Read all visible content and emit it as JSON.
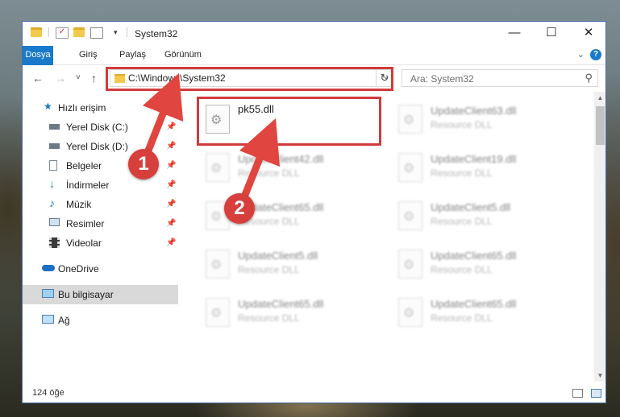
{
  "window": {
    "title": "System32",
    "controls": {
      "minimize": "—",
      "maximize": "☐",
      "close": "✕"
    }
  },
  "ribbon": {
    "tabs": [
      "Dosya",
      "Giriş",
      "Paylaş",
      "Görünüm"
    ],
    "help": "?"
  },
  "nav": {
    "back": "←",
    "forward": "→",
    "recent": "˅",
    "up": "↑",
    "address": "C:\\Windows\\System32",
    "refresh": "↻",
    "search_placeholder": "Ara: System32",
    "search_icon": "⚲"
  },
  "sidebar": {
    "items": [
      {
        "label": "Hızlı erişim",
        "icon": "star-icon",
        "pinned": false
      },
      {
        "label": "Yerel Disk (C:)",
        "icon": "drive-icon",
        "pinned": true
      },
      {
        "label": "Yerel Disk (D:)",
        "icon": "drive-icon",
        "pinned": true
      },
      {
        "label": "Belgeler",
        "icon": "documents-icon",
        "pinned": true
      },
      {
        "label": "İndirmeler",
        "icon": "download-icon",
        "pinned": true
      },
      {
        "label": "Müzik",
        "icon": "music-icon",
        "pinned": true
      },
      {
        "label": "Resimler",
        "icon": "pictures-icon",
        "pinned": true
      },
      {
        "label": "Videolar",
        "icon": "video-icon",
        "pinned": true
      },
      {
        "label": "OneDrive",
        "icon": "cloud-icon",
        "pinned": false
      },
      {
        "label": "Bu bilgisayar",
        "icon": "computer-icon",
        "pinned": false,
        "selected": true
      },
      {
        "label": "Ağ",
        "icon": "network-icon",
        "pinned": false
      }
    ]
  },
  "files": [
    {
      "name": "pk55.dll",
      "type": "",
      "highlighted": true
    },
    {
      "name": "UpdateClient63.dll",
      "type": "Resource DLL"
    },
    {
      "name": "UpdateClient42.dll",
      "type": "Resource DLL"
    },
    {
      "name": "UpdateClient19.dll",
      "type": "Resource DLL"
    },
    {
      "name": "UpdateClient65.dll",
      "type": "Resource DLL"
    },
    {
      "name": "UpdateClient5.dll",
      "type": "Resource DLL"
    },
    {
      "name": "UpdateClient5.dll",
      "type": "Resource DLL"
    },
    {
      "name": "UpdateClient65.dll",
      "type": "Resource DLL"
    },
    {
      "name": "UpdateClient65.dll",
      "type": "Resource DLL"
    },
    {
      "name": "UpdateClient65.dll",
      "type": "Resource DLL"
    }
  ],
  "status": {
    "count": "124 öğe"
  },
  "annotations": {
    "step1": "1",
    "step2": "2"
  },
  "colors": {
    "accent": "#1979ca",
    "highlight_red": "#d23a3a"
  }
}
